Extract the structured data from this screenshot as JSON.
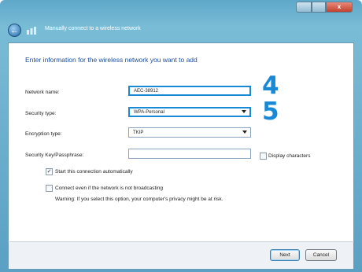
{
  "window": {
    "close_glyph": "x",
    "title": "Manually connect to a wireless network"
  },
  "form": {
    "heading": "Enter information for the wireless network you want to add",
    "network_name_label": "Network name:",
    "network_name_value": "AEC-38912",
    "security_type_label": "Security type:",
    "security_type_value": "WPA-Personal",
    "encryption_type_label": "Encryption type:",
    "encryption_type_value": "TKIP",
    "security_key_label": "Security Key/Passphrase:",
    "security_key_value": "",
    "display_characters_label": "Display characters",
    "display_characters_checked": false,
    "auto_start_label": "Start this connection automatically",
    "auto_start_checked": true,
    "auto_start_mark": "✓",
    "connect_hidden_label": "Connect even if the network is not broadcasting",
    "connect_hidden_checked": false,
    "warning_text": "Warning: If you select this option, your computer's privacy might be at risk."
  },
  "callouts": {
    "step_4": "4",
    "step_5": "5",
    "color": "#1889d6"
  },
  "buttons": {
    "next": "Next",
    "cancel": "Cancel"
  },
  "icons": {
    "back": "back-arrow-icon",
    "network": "wireless-network-icon"
  }
}
